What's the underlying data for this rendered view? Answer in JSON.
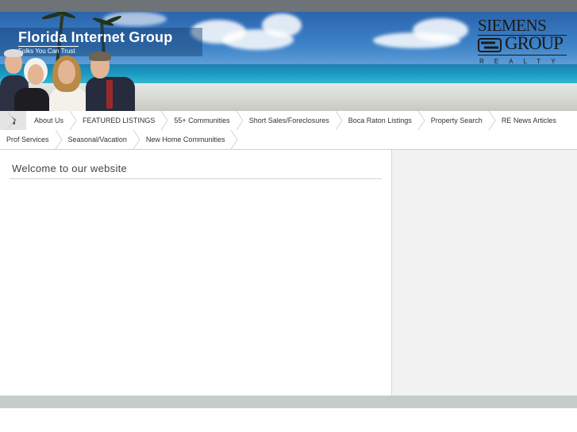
{
  "header": {
    "site_name": "Florida Internet Group",
    "tagline": "Folks You Can Trust",
    "logo": {
      "line1": "SIEMENS",
      "line2": "GROUP",
      "line3": "REALTY"
    }
  },
  "nav": {
    "home_icon": "home-icon",
    "row1": [
      {
        "label": "About Us"
      },
      {
        "label": "FEATURED LISTINGS"
      },
      {
        "label": "55+ Communities"
      },
      {
        "label": "Short Sales/Foreclosures"
      },
      {
        "label": "Boca Raton Listings"
      },
      {
        "label": "Property Search"
      },
      {
        "label": "RE News Articles"
      }
    ],
    "row2": [
      {
        "label": "Prof Services"
      },
      {
        "label": "Seasonal/Vacation"
      },
      {
        "label": "New Home Communities"
      }
    ]
  },
  "main": {
    "heading": "Welcome to our website"
  },
  "colors": {
    "topbar": "#6e7378",
    "nav_text": "#333333",
    "sidebar_bg": "#f2f2f2",
    "footer": "#c6cbcc"
  }
}
